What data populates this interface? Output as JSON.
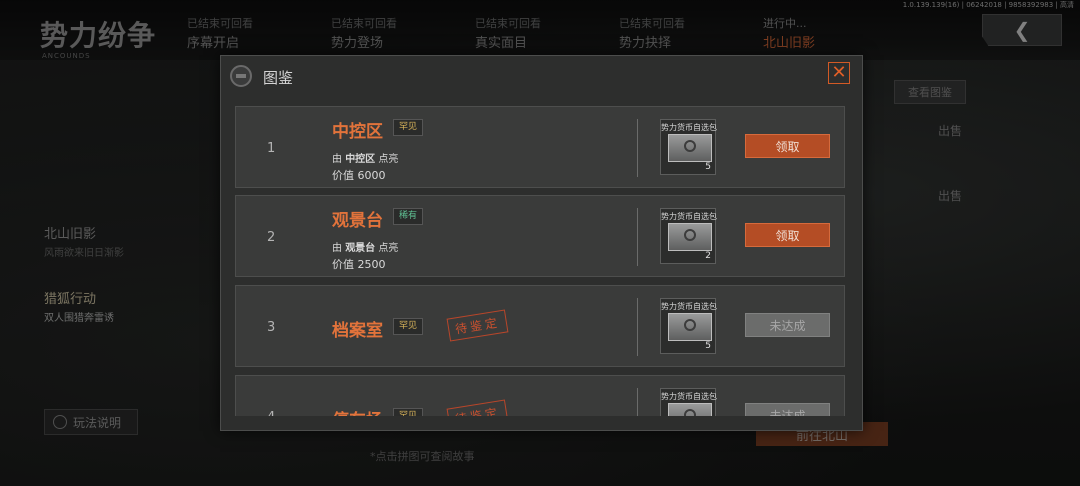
{
  "app": {
    "logo": "势力纷争",
    "logo_sub": "ANCOUNDS",
    "version": "1.0.139.139(16) | 06242018 | 9858392983 | 高清"
  },
  "stages": [
    {
      "status": "已结束可回看",
      "name": "序幕开启",
      "active": false
    },
    {
      "status": "已结束可回看",
      "name": "势力登场",
      "active": false
    },
    {
      "status": "已结束可回看",
      "name": "真实面目",
      "active": false
    },
    {
      "status": "已结束可回看",
      "name": "势力抉择",
      "active": false
    },
    {
      "status": "进行中...",
      "name": "北山旧影",
      "active": true
    }
  ],
  "left_menu": [
    {
      "title": "北山旧影",
      "sub": "风雨欲来旧日渐影"
    },
    {
      "title": "猎狐行动",
      "sub": "双人围猎奔雷诱"
    }
  ],
  "rules_button": "玩法说明",
  "view_atlas_button": "查看图鉴",
  "sell_labels": [
    "出售",
    "出售"
  ],
  "goto_button": "前往北山",
  "hint": "*点击拼图可查阅故事",
  "modal": {
    "title": "图鉴",
    "close_icon": "close-x-icon",
    "rows": [
      {
        "index": "1",
        "name": "中控区",
        "rarity": "罕见",
        "rarity_class": "common",
        "desc_prefix": "由",
        "desc_name": "中控区",
        "desc_suffix": "点亮",
        "value": "价值 6000",
        "reward_name": "势力货币自选包",
        "reward_count": "5",
        "action": "领取",
        "action_state": "claim",
        "stamp": ""
      },
      {
        "index": "2",
        "name": "观景台",
        "rarity": "稀有",
        "rarity_class": "rare",
        "desc_prefix": "由",
        "desc_name": "观景台",
        "desc_suffix": "点亮",
        "value": "价值 2500",
        "reward_name": "势力货币自选包",
        "reward_count": "2",
        "action": "领取",
        "action_state": "claim",
        "stamp": ""
      },
      {
        "index": "3",
        "name": "档案室",
        "rarity": "罕见",
        "rarity_class": "common",
        "desc_prefix": "",
        "desc_name": "",
        "desc_suffix": "",
        "value": "",
        "reward_name": "势力货币自选包",
        "reward_count": "5",
        "action": "未达成",
        "action_state": "locked",
        "stamp": "待鉴定"
      },
      {
        "index": "4",
        "name": "停车场",
        "rarity": "罕见",
        "rarity_class": "common",
        "desc_prefix": "",
        "desc_name": "",
        "desc_suffix": "",
        "value": "",
        "reward_name": "势力货币自选包",
        "reward_count": "",
        "action": "未达成",
        "action_state": "locked",
        "stamp": "待鉴定"
      }
    ]
  }
}
